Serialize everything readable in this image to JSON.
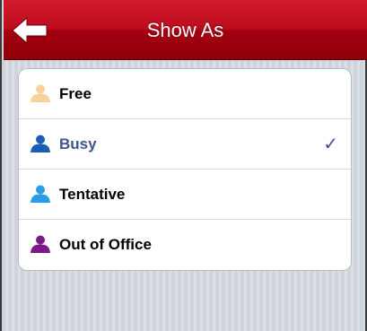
{
  "navbar": {
    "title": "Show As",
    "back_icon": "left-arrow-icon"
  },
  "options": [
    {
      "label": "Free",
      "icon": "person-icon",
      "icon_color": "#f7d29a",
      "selected": false
    },
    {
      "label": "Busy",
      "icon": "person-icon",
      "icon_color": "#1c5db3",
      "selected": true
    },
    {
      "label": "Tentative",
      "icon": "person-icon",
      "icon_color": "#2a9be6",
      "selected": false
    },
    {
      "label": "Out of Office",
      "icon": "person-icon",
      "icon_color": "#7a1a86",
      "selected": false
    }
  ],
  "check_mark": "✓",
  "colors": {
    "navbar": "#b30f1e",
    "selected_text": "#3e5687",
    "background": "#d3d7df"
  }
}
